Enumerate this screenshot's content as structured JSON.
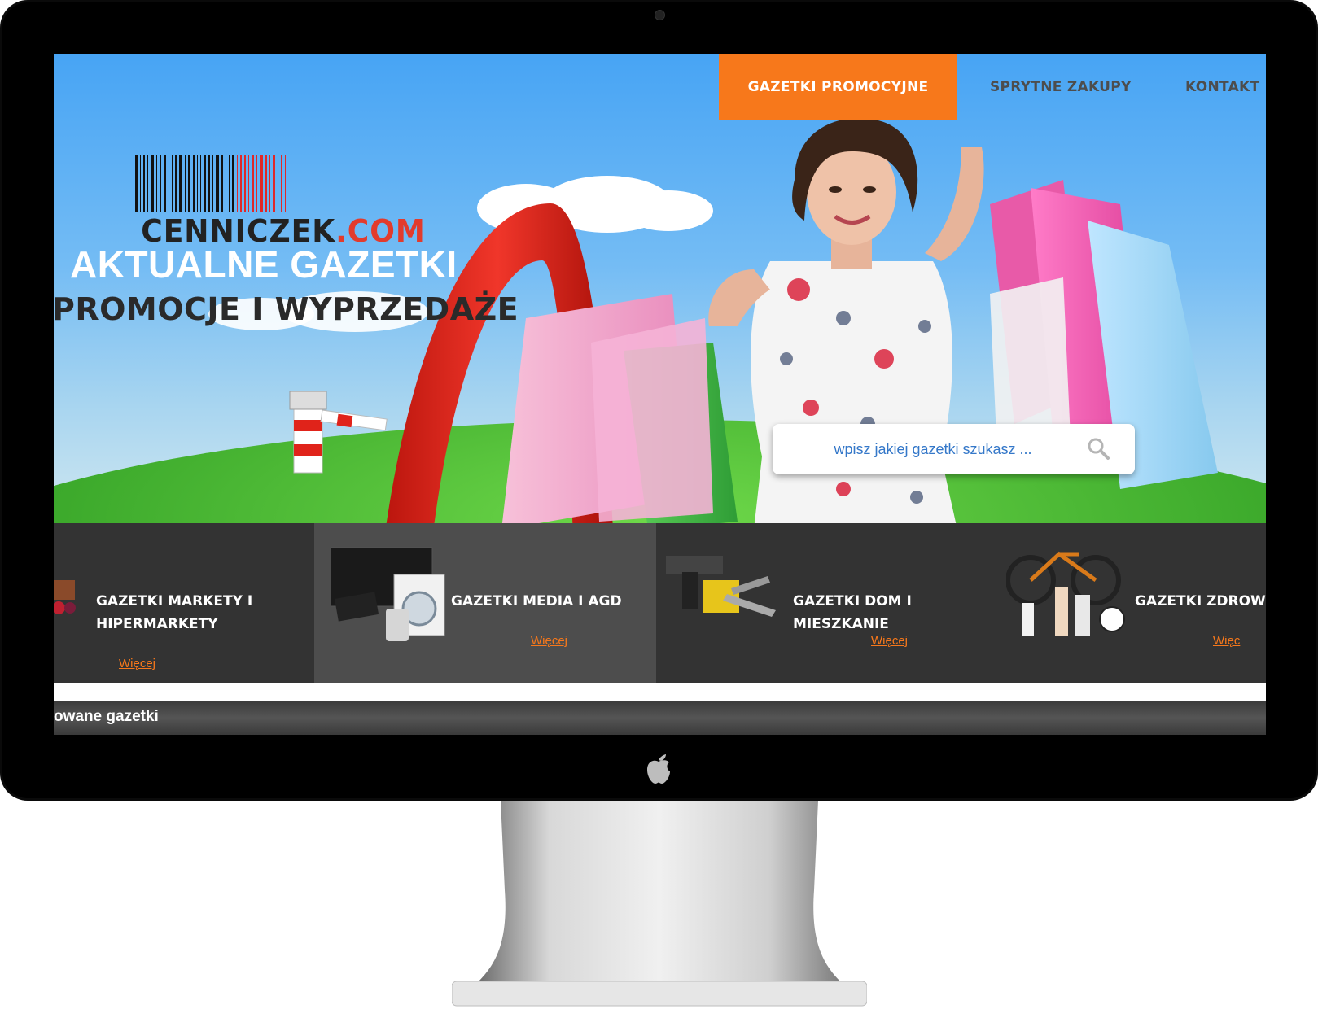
{
  "nav": {
    "items": [
      {
        "label": "GAZETKI PROMOCYJNE",
        "active": true
      },
      {
        "label": "SPRYTNE ZAKUPY",
        "active": false
      },
      {
        "label": "KONTAKT",
        "active": false
      }
    ]
  },
  "hero": {
    "logo_text_main": "CENNICZEK",
    "logo_text_domain": ".COM",
    "title": "AKTUALNE GAZETKI",
    "subtitle": "PROMOCJE I WYPRZEDAŻE"
  },
  "search": {
    "placeholder": "wpisz jakiej gazetki szukasz ..."
  },
  "categories": [
    {
      "title_line1": "GAZETKI MARKETY I",
      "title_line2": "HIPERMARKETY",
      "more": "Więcej",
      "icon": "grocery-icon"
    },
    {
      "title_line1": "GAZETKI MEDIA I AGD",
      "title_line2": "",
      "more": "Więcej",
      "icon": "electronics-icon"
    },
    {
      "title_line1": "GAZETKI DOM I MIESZKANIE",
      "title_line2": "",
      "more": "Więcej",
      "icon": "tools-icon"
    },
    {
      "title_line1": "GAZETKI ZDROW",
      "title_line2": "",
      "more": "Więc",
      "icon": "health-sport-icon"
    }
  ],
  "section_bar": {
    "label": "owane gazetki"
  },
  "colors": {
    "accent": "#f7781b",
    "sky": "#47a4f4",
    "band_dark": "#333333",
    "band_light": "#4d4d4d"
  }
}
